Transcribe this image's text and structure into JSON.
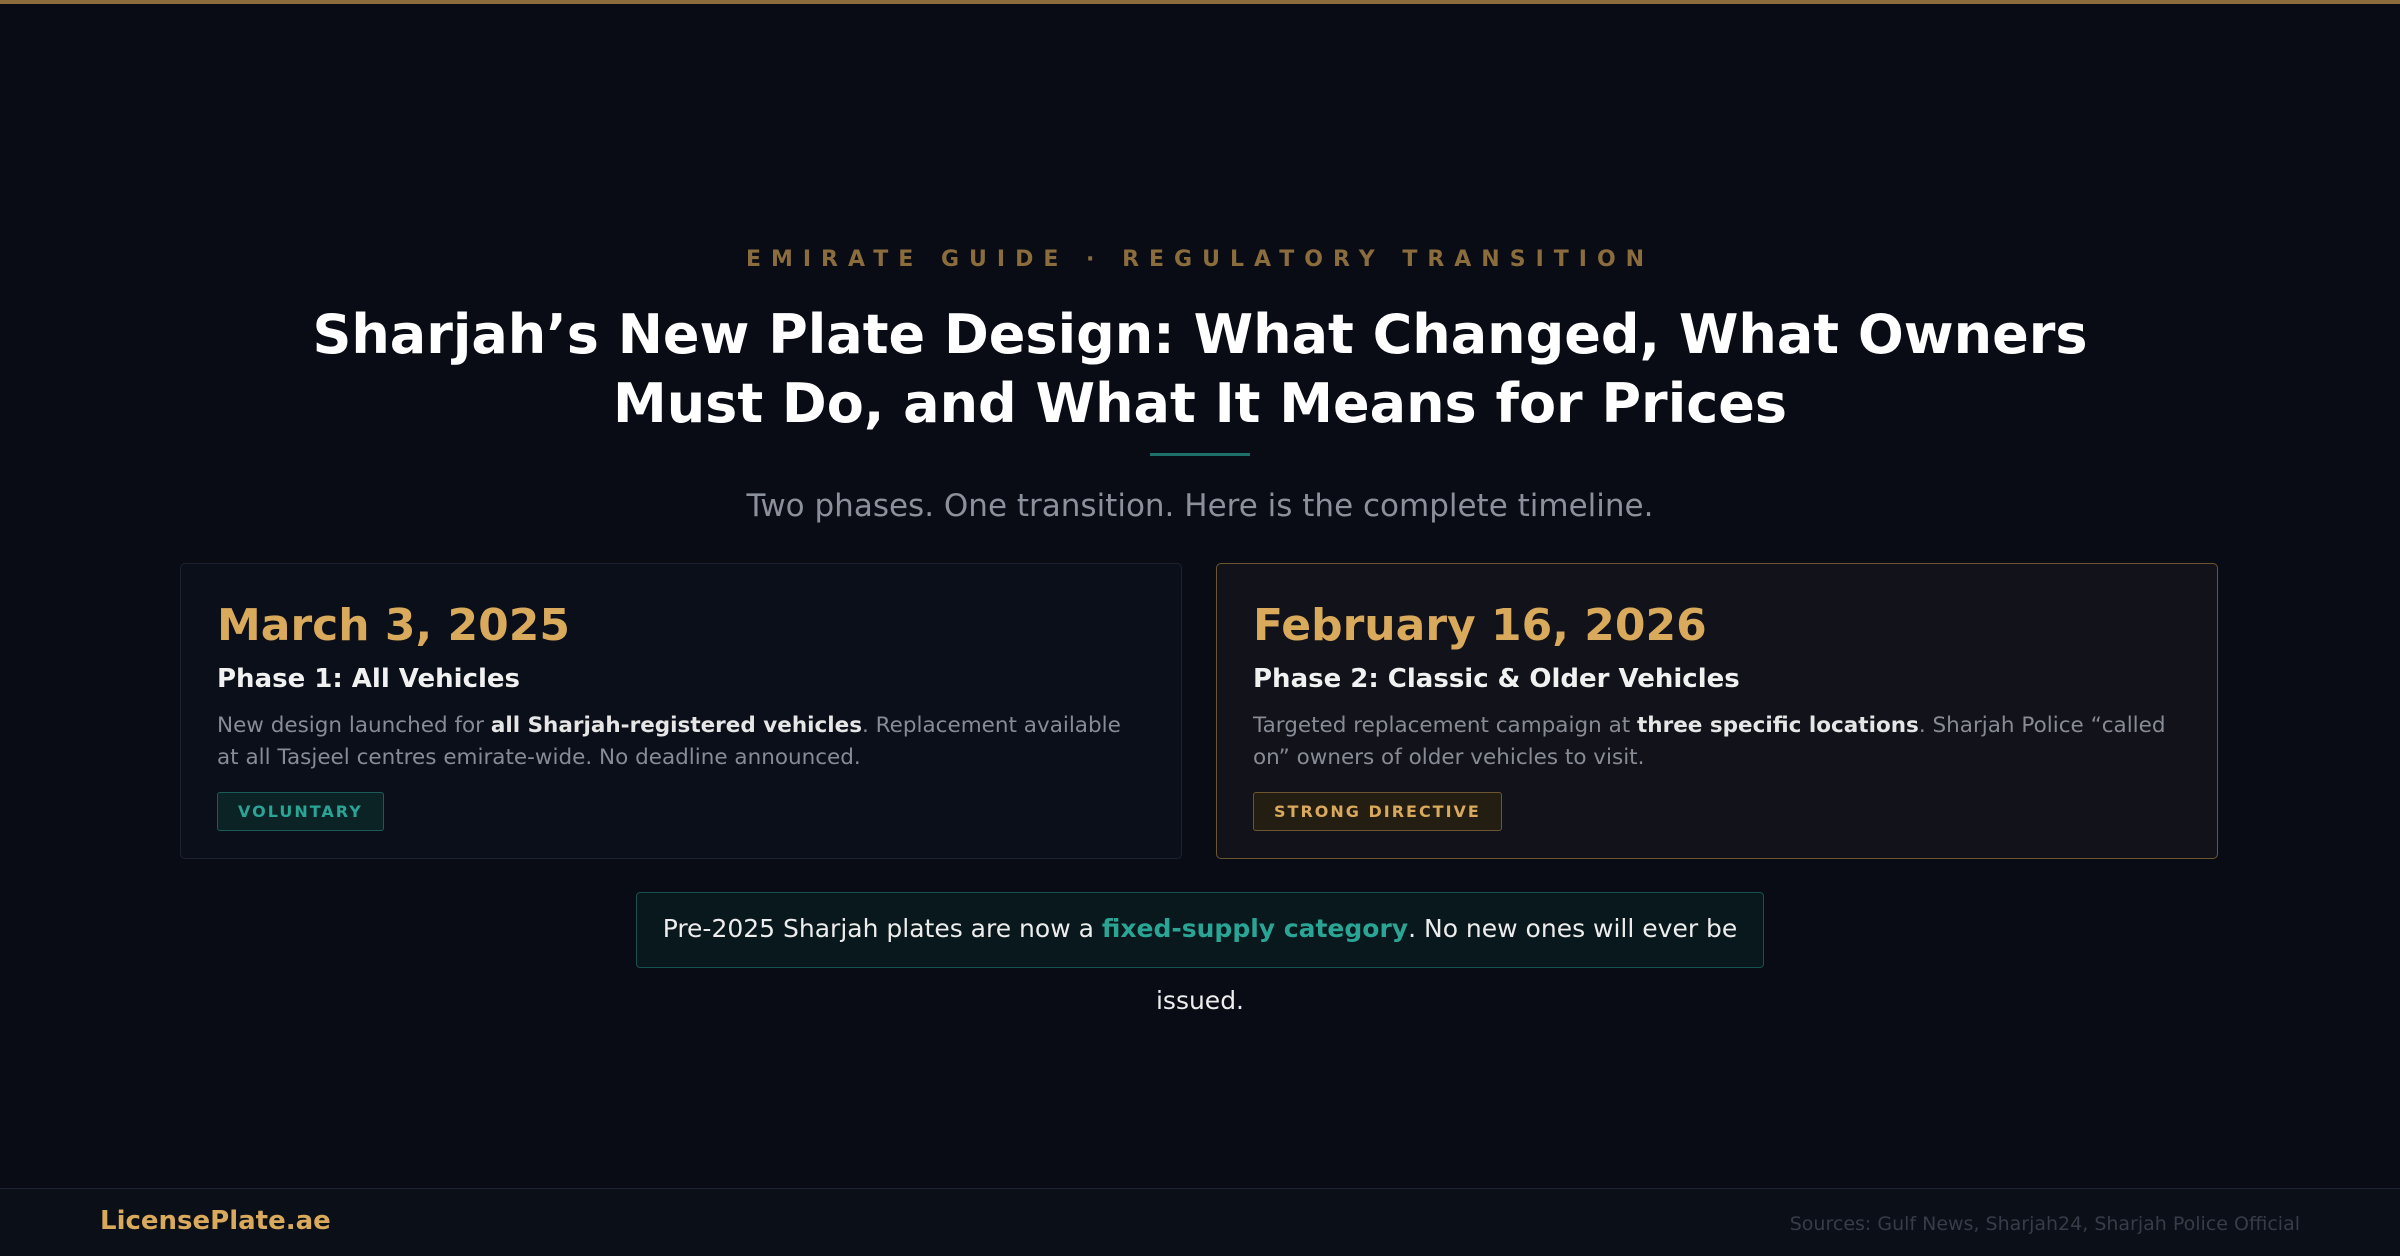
{
  "header": {
    "eyebrow": "EMIRATE GUIDE · REGULATORY TRANSITION",
    "title": "Sharjah’s New Plate Design: What Changed, What Owners Must Do, and What It Means for Prices",
    "subtitle": "Two phases. One transition. Here is the complete timeline."
  },
  "phases": [
    {
      "date": "March 3, 2025",
      "title": "Phase 1: All Vehicles",
      "desc_before": "New design launched for ",
      "desc_bold": "all Sharjah-registered vehicles",
      "desc_after": ". Replacement available at all Tasjeel centres emirate-wide. No deadline announced.",
      "badge": "VOLUNTARY"
    },
    {
      "date": "February 16, 2026",
      "title": "Phase 2: Classic & Older Vehicles",
      "desc_before": "Targeted replacement campaign at ",
      "desc_bold": "three specific locations",
      "desc_after": ". Sharjah Police “called on” owners of older vehicles to visit.",
      "badge": "STRONG DIRECTIVE"
    }
  ],
  "callout": {
    "before": "Pre-2025 Sharjah plates are now a ",
    "accent": "fixed-supply category",
    "after": ". No new ones will ever be issued."
  },
  "footer": {
    "brand": "LicensePlate.ae",
    "sources": "Sources: Gulf News, Sharjah24, Sharjah Police Official"
  },
  "colors": {
    "background": "#090c15",
    "gold": "#d9a95c",
    "teal": "#2aa595",
    "muted_gold": "#8a6c3d"
  }
}
